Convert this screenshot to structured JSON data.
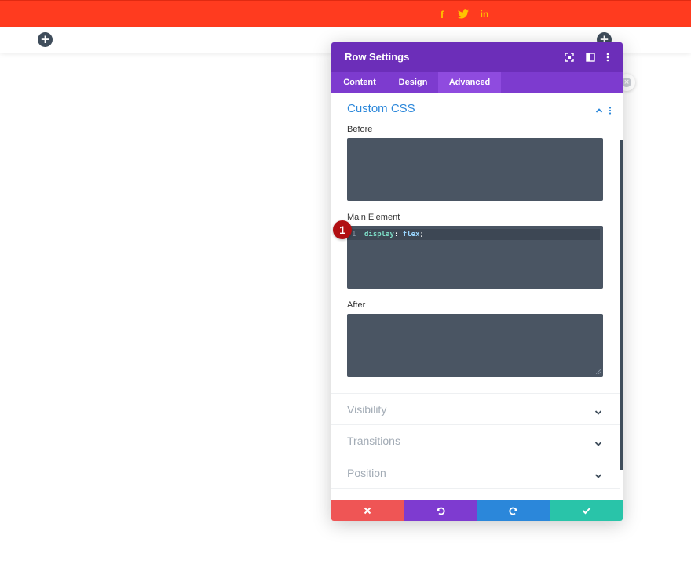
{
  "header": {
    "social": {
      "facebook": "f",
      "linkedin": "in"
    },
    "icons": [
      "facebook-icon",
      "twitter-icon",
      "linkedin-icon"
    ],
    "colors": {
      "bar": "#ff3b1f",
      "social": "#ffc200"
    }
  },
  "builder": {
    "add_symbol": "+"
  },
  "modal": {
    "title": "Row Settings",
    "tabs": [
      {
        "label": "Content"
      },
      {
        "label": "Design"
      },
      {
        "label": "Advanced"
      }
    ],
    "active_tab": "Advanced",
    "custom_css": {
      "title": "Custom CSS",
      "fields": {
        "before": {
          "label": "Before"
        },
        "main": {
          "label": "Main Element",
          "line_number": "1",
          "property": "display",
          "colon": ":",
          "value": "flex",
          "semicolon": ";"
        },
        "after": {
          "label": "After"
        }
      }
    },
    "groups": [
      {
        "label": "Visibility"
      },
      {
        "label": "Transitions"
      },
      {
        "label": "Position"
      }
    ],
    "footer_icons": [
      "close-icon",
      "undo-icon",
      "redo-icon",
      "check-icon"
    ],
    "colors": {
      "header": "#6c2eb9",
      "tabs": "#7d3bcf",
      "cancel": "#ef5555",
      "undo": "#7e3bd0",
      "redo": "#2b87da",
      "save": "#29c4a9",
      "accent": "#2b87da"
    }
  },
  "annotation": {
    "marker": "1"
  }
}
